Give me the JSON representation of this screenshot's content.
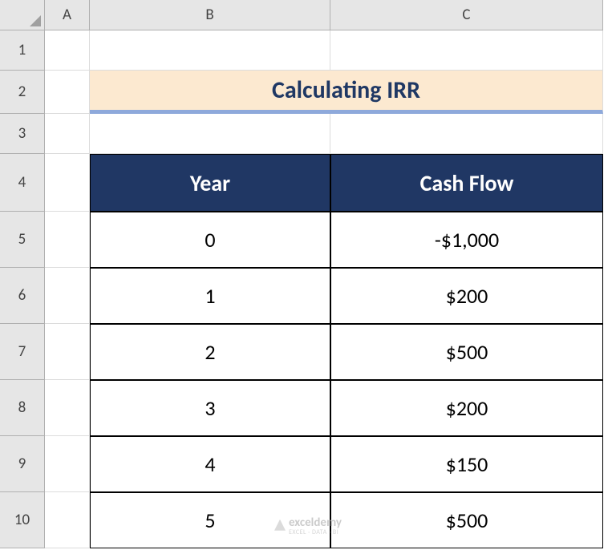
{
  "columns": [
    "A",
    "B",
    "C"
  ],
  "rows": [
    "1",
    "2",
    "3",
    "4",
    "5",
    "6",
    "7",
    "8",
    "9",
    "10"
  ],
  "title": "Calculating IRR",
  "table": {
    "headers": {
      "year": "Year",
      "cashflow": "Cash Flow"
    },
    "data": [
      {
        "year": "0",
        "cashflow": "-$1,000"
      },
      {
        "year": "1",
        "cashflow": "$200"
      },
      {
        "year": "2",
        "cashflow": "$500"
      },
      {
        "year": "3",
        "cashflow": "$200"
      },
      {
        "year": "4",
        "cashflow": "$150"
      },
      {
        "year": "5",
        "cashflow": "$500"
      }
    ]
  },
  "watermark": {
    "brand": "exceldemy",
    "tagline": "EXCEL · DATA · BI"
  }
}
